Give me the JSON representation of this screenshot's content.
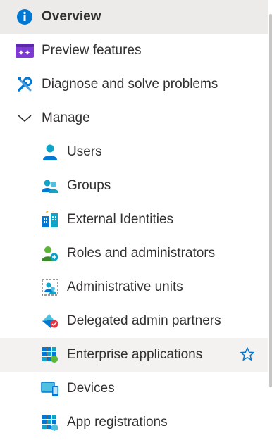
{
  "nav": {
    "items": [
      {
        "label": "Overview"
      },
      {
        "label": "Preview features"
      },
      {
        "label": "Diagnose and solve problems"
      },
      {
        "label": "Manage"
      },
      {
        "label": "Users"
      },
      {
        "label": "Groups"
      },
      {
        "label": "External Identities"
      },
      {
        "label": "Roles and administrators"
      },
      {
        "label": "Administrative units"
      },
      {
        "label": "Delegated admin partners"
      },
      {
        "label": "Enterprise applications"
      },
      {
        "label": "Devices"
      },
      {
        "label": "App registrations"
      }
    ],
    "selected": "Overview",
    "hovered": "Enterprise applications",
    "expanded_group": "Manage"
  },
  "icons": {
    "overview": "info-icon",
    "preview": "preview-features-icon",
    "diagnose": "wrench-screwdriver-icon",
    "manage": "chevron-down-icon",
    "users": "user-icon",
    "groups": "group-icon",
    "external": "external-identities-icon",
    "roles": "roles-icon",
    "admin_units": "administrative-units-icon",
    "delegated": "delegated-admin-icon",
    "enterprise": "enterprise-apps-icon",
    "devices": "devices-icon",
    "app_reg": "app-registrations-icon",
    "favorite": "star-icon"
  },
  "colors": {
    "accent": "#0078d4",
    "selected_bg": "#edebe9",
    "text": "#323130"
  }
}
